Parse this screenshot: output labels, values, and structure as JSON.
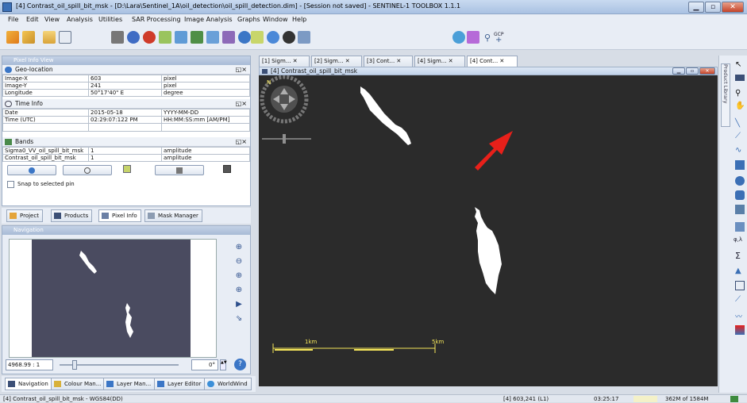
{
  "window": {
    "title": "[4] Contrast_oil_spill_bit_msk - [D:\\Lara\\Sentinel_1A\\oil_detection\\oil_spill_detection.dim] - [Session not saved] - SENTINEL-1 TOOLBOX 1.1.1"
  },
  "menu": {
    "items": [
      "File",
      "Edit",
      "View",
      "Analysis",
      "Utilities",
      "SAR Processing",
      "Image Analysis",
      "Graphs",
      "Window",
      "Help"
    ]
  },
  "toolbar": {
    "gcp_label": "GCP"
  },
  "pixel_info": {
    "panel_title": "Pixel Info View",
    "geo": {
      "title": "Geo-location",
      "rows": [
        [
          "Image-X",
          "603",
          "pixel"
        ],
        [
          "Image-Y",
          "241",
          "pixel"
        ],
        [
          "Longitude",
          "50°17'40\" E",
          "degree"
        ]
      ]
    },
    "time": {
      "title": "Time Info",
      "rows": [
        [
          "Date",
          "2015-05-18",
          "YYYY-MM-DD"
        ],
        [
          "Time (UTC)",
          "02:29:07:122 PM",
          "HH:MM:SS:mm [AM/PM]"
        ]
      ]
    },
    "bands": {
      "title": "Bands",
      "rows": [
        [
          "Sigma0_VV_oil_spill_bit_msk",
          "1",
          "amplitude"
        ],
        [
          "Contrast_oil_spill_bit_msk",
          "1",
          "amplitude"
        ]
      ]
    },
    "snap_label": "Snap to selected pin"
  },
  "left_tabs": [
    "Project",
    "Products",
    "Pixel Info",
    "Mask Manager"
  ],
  "navigation": {
    "panel_title": "Navigation",
    "scale_value": "4968.99 : 1",
    "rotation_value": "0°"
  },
  "bottom_tabs": [
    "Navigation",
    "Colour Man...",
    "Layer Man...",
    "Layer Editor",
    "WorldWind"
  ],
  "doc_tabs": [
    "[1] Sigm...",
    "[2] Sigm...",
    "[3] Cont...",
    "[4] Sigm...",
    "[4] Cont..."
  ],
  "image_window": {
    "title": "[4] Contrast_oil_spill_bit_msk",
    "scale_labels": [
      "1km",
      "5km"
    ],
    "north_label": "N"
  },
  "right_sidebar": {
    "label": "Product Library"
  },
  "status": {
    "left": "[4] Contrast_oil_spill_bit_msk - WGS84(DD)",
    "pixel": "[4] 603,241 (L1)",
    "time": "03:25:17",
    "memory": "362M of 1584M"
  },
  "colors": {
    "image_background": "#2b2b2b",
    "mask": "#ffffff",
    "arrow": "#e8201a",
    "scalebar": "#f5e65a",
    "nav_background": "#4a4b60"
  }
}
